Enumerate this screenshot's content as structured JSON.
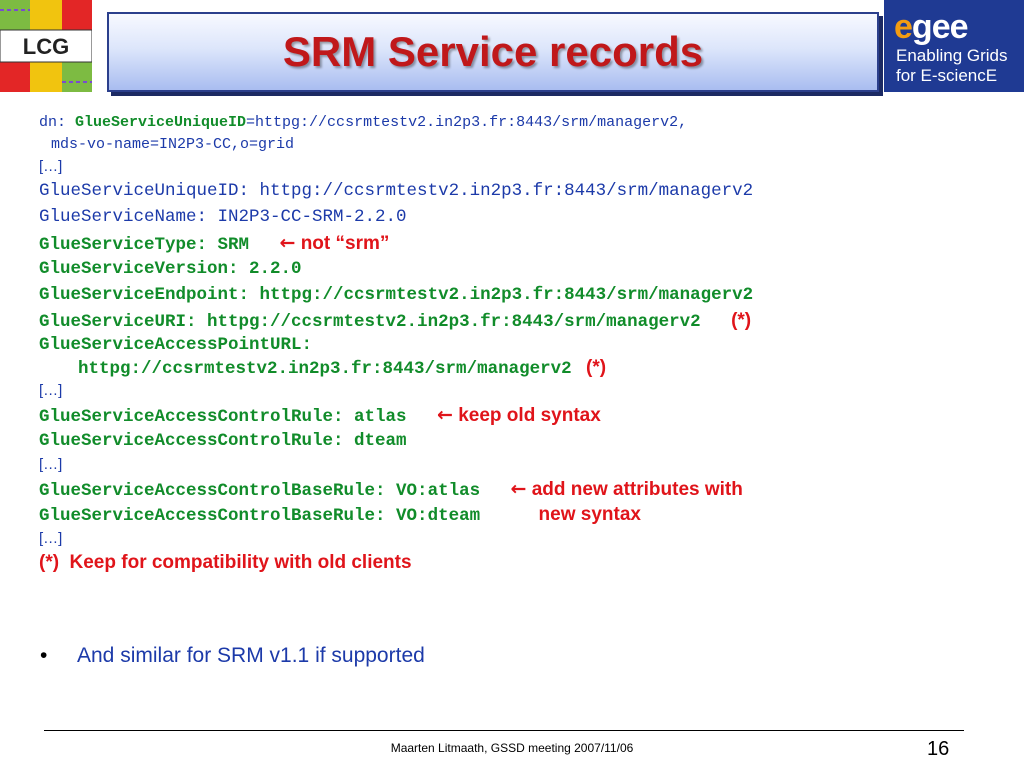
{
  "header": {
    "title": "SRM Service records",
    "lcg_logo": "LCG",
    "egee_logo": {
      "word_e1": "e",
      "word_rest": "gee",
      "tagline1": "Enabling Grids",
      "tagline2": "for E-sciencE"
    }
  },
  "body": {
    "dn_label": "dn: ",
    "dn_key": "GlueServiceUniqueID",
    "dn_value": "=httpg://ccsrmtestv2.in2p3.fr:8443/srm/managerv2,",
    "dn_line2": "mds-vo-name=IN2P3-CC,o=grid",
    "ellipsis": "[…]",
    "unique_id": "GlueServiceUniqueID: httpg://ccsrmtestv2.in2p3.fr:8443/srm/managerv2",
    "service_name": "GlueServiceName: IN2P3-CC-SRM-2.2.0",
    "service_type": "GlueServiceType: SRM",
    "service_type_note": "not “srm”",
    "service_version": "GlueServiceVersion: 2.2.0",
    "service_endpoint": "GlueServiceEndpoint: httpg://ccsrmtestv2.in2p3.fr:8443/srm/managerv2",
    "service_uri": "GlueServiceURI: httpg://ccsrmtestv2.in2p3.fr:8443/srm/managerv2",
    "compat_mark": "(*)",
    "access_point_label": "GlueServiceAccessPointURL:",
    "access_point_value": "httpg://ccsrmtestv2.in2p3.fr:8443/srm/managerv2",
    "acr_atlas": "GlueServiceAccessControlRule: atlas",
    "acr_atlas_note": "keep old syntax",
    "acr_dteam": "GlueServiceAccessControlRule: dteam",
    "acbr_atlas": "GlueServiceAccessControlBaseRule: VO:atlas",
    "acbr_note_line1": "add new attributes with",
    "acbr_dteam": "GlueServiceAccessControlBaseRule: VO:dteam",
    "acbr_note_line2": "new syntax",
    "compat_note_mark": "(*)",
    "compat_note": "Keep for compatibility with old clients",
    "bullet_symbol": "•",
    "bullet": "And similar for SRM v1.1 if supported"
  },
  "footer": {
    "text": "Maarten Litmaath, GSSD meeting 2007/11/06",
    "page": "16"
  },
  "colors": {
    "title": "#c0181a",
    "blue_text": "#1c3aa9",
    "green_text": "#118c2a",
    "red_note": "#e0141a",
    "egee_bg": "#1f3a93"
  },
  "icons": {
    "arrow": "left-arrow-icon"
  }
}
